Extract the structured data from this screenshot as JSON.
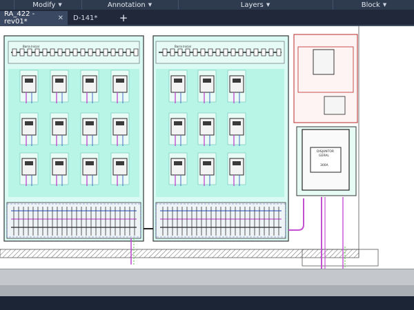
{
  "ribbon": {
    "panels": [
      {
        "label": "Modify"
      },
      {
        "label": "Annotation"
      },
      {
        "label": "Layers"
      },
      {
        "label": "Block"
      }
    ]
  },
  "tabs": [
    {
      "label": "RA_422 - rev01*",
      "active": true
    },
    {
      "label": "D-141*",
      "active": false
    }
  ],
  "new_tab_label": "+",
  "drawing": {
    "panel_labels": [
      "Barra Inicial",
      "Barra Inicial"
    ],
    "breaker_text": [
      "DISJUNTOR",
      "GERAL",
      "300A"
    ]
  },
  "colors": {
    "ribbon": "#2e3a4d",
    "tab_active": "#3b4861",
    "cyan": "#4fe0c8",
    "magenta": "#c34fd1",
    "red": "#b82828",
    "green": "#6fd35a"
  }
}
